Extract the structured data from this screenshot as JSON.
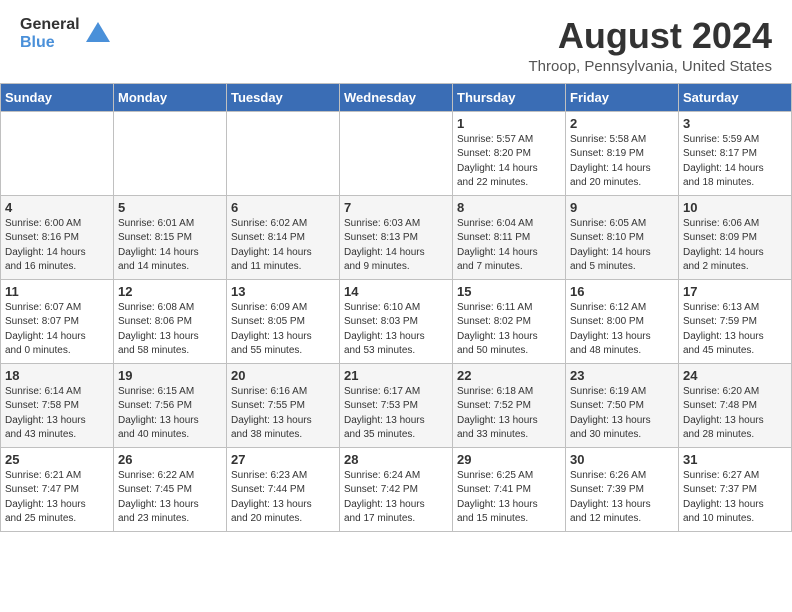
{
  "header": {
    "logo_general": "General",
    "logo_blue": "Blue",
    "title": "August 2024",
    "location": "Throop, Pennsylvania, United States"
  },
  "days_of_week": [
    "Sunday",
    "Monday",
    "Tuesday",
    "Wednesday",
    "Thursday",
    "Friday",
    "Saturday"
  ],
  "weeks": [
    [
      {
        "day": "",
        "content": ""
      },
      {
        "day": "",
        "content": ""
      },
      {
        "day": "",
        "content": ""
      },
      {
        "day": "",
        "content": ""
      },
      {
        "day": "1",
        "content": "Sunrise: 5:57 AM\nSunset: 8:20 PM\nDaylight: 14 hours\nand 22 minutes."
      },
      {
        "day": "2",
        "content": "Sunrise: 5:58 AM\nSunset: 8:19 PM\nDaylight: 14 hours\nand 20 minutes."
      },
      {
        "day": "3",
        "content": "Sunrise: 5:59 AM\nSunset: 8:17 PM\nDaylight: 14 hours\nand 18 minutes."
      }
    ],
    [
      {
        "day": "4",
        "content": "Sunrise: 6:00 AM\nSunset: 8:16 PM\nDaylight: 14 hours\nand 16 minutes."
      },
      {
        "day": "5",
        "content": "Sunrise: 6:01 AM\nSunset: 8:15 PM\nDaylight: 14 hours\nand 14 minutes."
      },
      {
        "day": "6",
        "content": "Sunrise: 6:02 AM\nSunset: 8:14 PM\nDaylight: 14 hours\nand 11 minutes."
      },
      {
        "day": "7",
        "content": "Sunrise: 6:03 AM\nSunset: 8:13 PM\nDaylight: 14 hours\nand 9 minutes."
      },
      {
        "day": "8",
        "content": "Sunrise: 6:04 AM\nSunset: 8:11 PM\nDaylight: 14 hours\nand 7 minutes."
      },
      {
        "day": "9",
        "content": "Sunrise: 6:05 AM\nSunset: 8:10 PM\nDaylight: 14 hours\nand 5 minutes."
      },
      {
        "day": "10",
        "content": "Sunrise: 6:06 AM\nSunset: 8:09 PM\nDaylight: 14 hours\nand 2 minutes."
      }
    ],
    [
      {
        "day": "11",
        "content": "Sunrise: 6:07 AM\nSunset: 8:07 PM\nDaylight: 14 hours\nand 0 minutes."
      },
      {
        "day": "12",
        "content": "Sunrise: 6:08 AM\nSunset: 8:06 PM\nDaylight: 13 hours\nand 58 minutes."
      },
      {
        "day": "13",
        "content": "Sunrise: 6:09 AM\nSunset: 8:05 PM\nDaylight: 13 hours\nand 55 minutes."
      },
      {
        "day": "14",
        "content": "Sunrise: 6:10 AM\nSunset: 8:03 PM\nDaylight: 13 hours\nand 53 minutes."
      },
      {
        "day": "15",
        "content": "Sunrise: 6:11 AM\nSunset: 8:02 PM\nDaylight: 13 hours\nand 50 minutes."
      },
      {
        "day": "16",
        "content": "Sunrise: 6:12 AM\nSunset: 8:00 PM\nDaylight: 13 hours\nand 48 minutes."
      },
      {
        "day": "17",
        "content": "Sunrise: 6:13 AM\nSunset: 7:59 PM\nDaylight: 13 hours\nand 45 minutes."
      }
    ],
    [
      {
        "day": "18",
        "content": "Sunrise: 6:14 AM\nSunset: 7:58 PM\nDaylight: 13 hours\nand 43 minutes."
      },
      {
        "day": "19",
        "content": "Sunrise: 6:15 AM\nSunset: 7:56 PM\nDaylight: 13 hours\nand 40 minutes."
      },
      {
        "day": "20",
        "content": "Sunrise: 6:16 AM\nSunset: 7:55 PM\nDaylight: 13 hours\nand 38 minutes."
      },
      {
        "day": "21",
        "content": "Sunrise: 6:17 AM\nSunset: 7:53 PM\nDaylight: 13 hours\nand 35 minutes."
      },
      {
        "day": "22",
        "content": "Sunrise: 6:18 AM\nSunset: 7:52 PM\nDaylight: 13 hours\nand 33 minutes."
      },
      {
        "day": "23",
        "content": "Sunrise: 6:19 AM\nSunset: 7:50 PM\nDaylight: 13 hours\nand 30 minutes."
      },
      {
        "day": "24",
        "content": "Sunrise: 6:20 AM\nSunset: 7:48 PM\nDaylight: 13 hours\nand 28 minutes."
      }
    ],
    [
      {
        "day": "25",
        "content": "Sunrise: 6:21 AM\nSunset: 7:47 PM\nDaylight: 13 hours\nand 25 minutes."
      },
      {
        "day": "26",
        "content": "Sunrise: 6:22 AM\nSunset: 7:45 PM\nDaylight: 13 hours\nand 23 minutes."
      },
      {
        "day": "27",
        "content": "Sunrise: 6:23 AM\nSunset: 7:44 PM\nDaylight: 13 hours\nand 20 minutes."
      },
      {
        "day": "28",
        "content": "Sunrise: 6:24 AM\nSunset: 7:42 PM\nDaylight: 13 hours\nand 17 minutes."
      },
      {
        "day": "29",
        "content": "Sunrise: 6:25 AM\nSunset: 7:41 PM\nDaylight: 13 hours\nand 15 minutes."
      },
      {
        "day": "30",
        "content": "Sunrise: 6:26 AM\nSunset: 7:39 PM\nDaylight: 13 hours\nand 12 minutes."
      },
      {
        "day": "31",
        "content": "Sunrise: 6:27 AM\nSunset: 7:37 PM\nDaylight: 13 hours\nand 10 minutes."
      }
    ]
  ]
}
